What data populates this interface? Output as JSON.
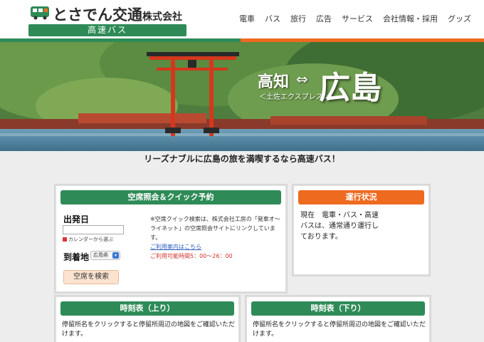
{
  "header": {
    "company_name": "とさでん交通",
    "company_suffix": "株式会社",
    "service_badge": "高速バス",
    "nav": [
      "電車",
      "バス",
      "旅行",
      "広告",
      "サービス",
      "会社情報・採用",
      "グッズ"
    ]
  },
  "colors": {
    "brand_green": "#2e8b57",
    "brand_orange": "#ee6a1f"
  },
  "hero": {
    "origin": "高知",
    "arrow": "⇔",
    "destination": "広島",
    "route_name": "＜土佐エクスプレス＞"
  },
  "tagline": "リーズナブルに広島の旅を満喫するなら高速バス！",
  "booking": {
    "heading": "空席照会＆クイック予約",
    "departure_label": "出発日",
    "date_value": "",
    "calendar_link": "カレンダーから選ぶ",
    "arrival_label": "到着地",
    "destination_select": "広島県",
    "search_button": "空席を検索",
    "note_text": "※空席クイック検索は、株式会社工房の「発車オ〜ライネット」の空席照会サイトにリンクしています。",
    "usage_link": "ご利用案内はこちら",
    "hours": "ご利用可能時間5：00〜26：00"
  },
  "status": {
    "heading": "運行状況",
    "text": "現在　電車・バス・高速バスは、通常通り運行しております。"
  },
  "timetable_up": {
    "heading": "時刻表（上り）",
    "text": "停留所名をクリックすると停留所周辺の地図をご確認いただけます。"
  },
  "timetable_down": {
    "heading": "時刻表（下り）",
    "text": "停留所名をクリックすると停留所周辺の地図をご確認いただけます。"
  }
}
